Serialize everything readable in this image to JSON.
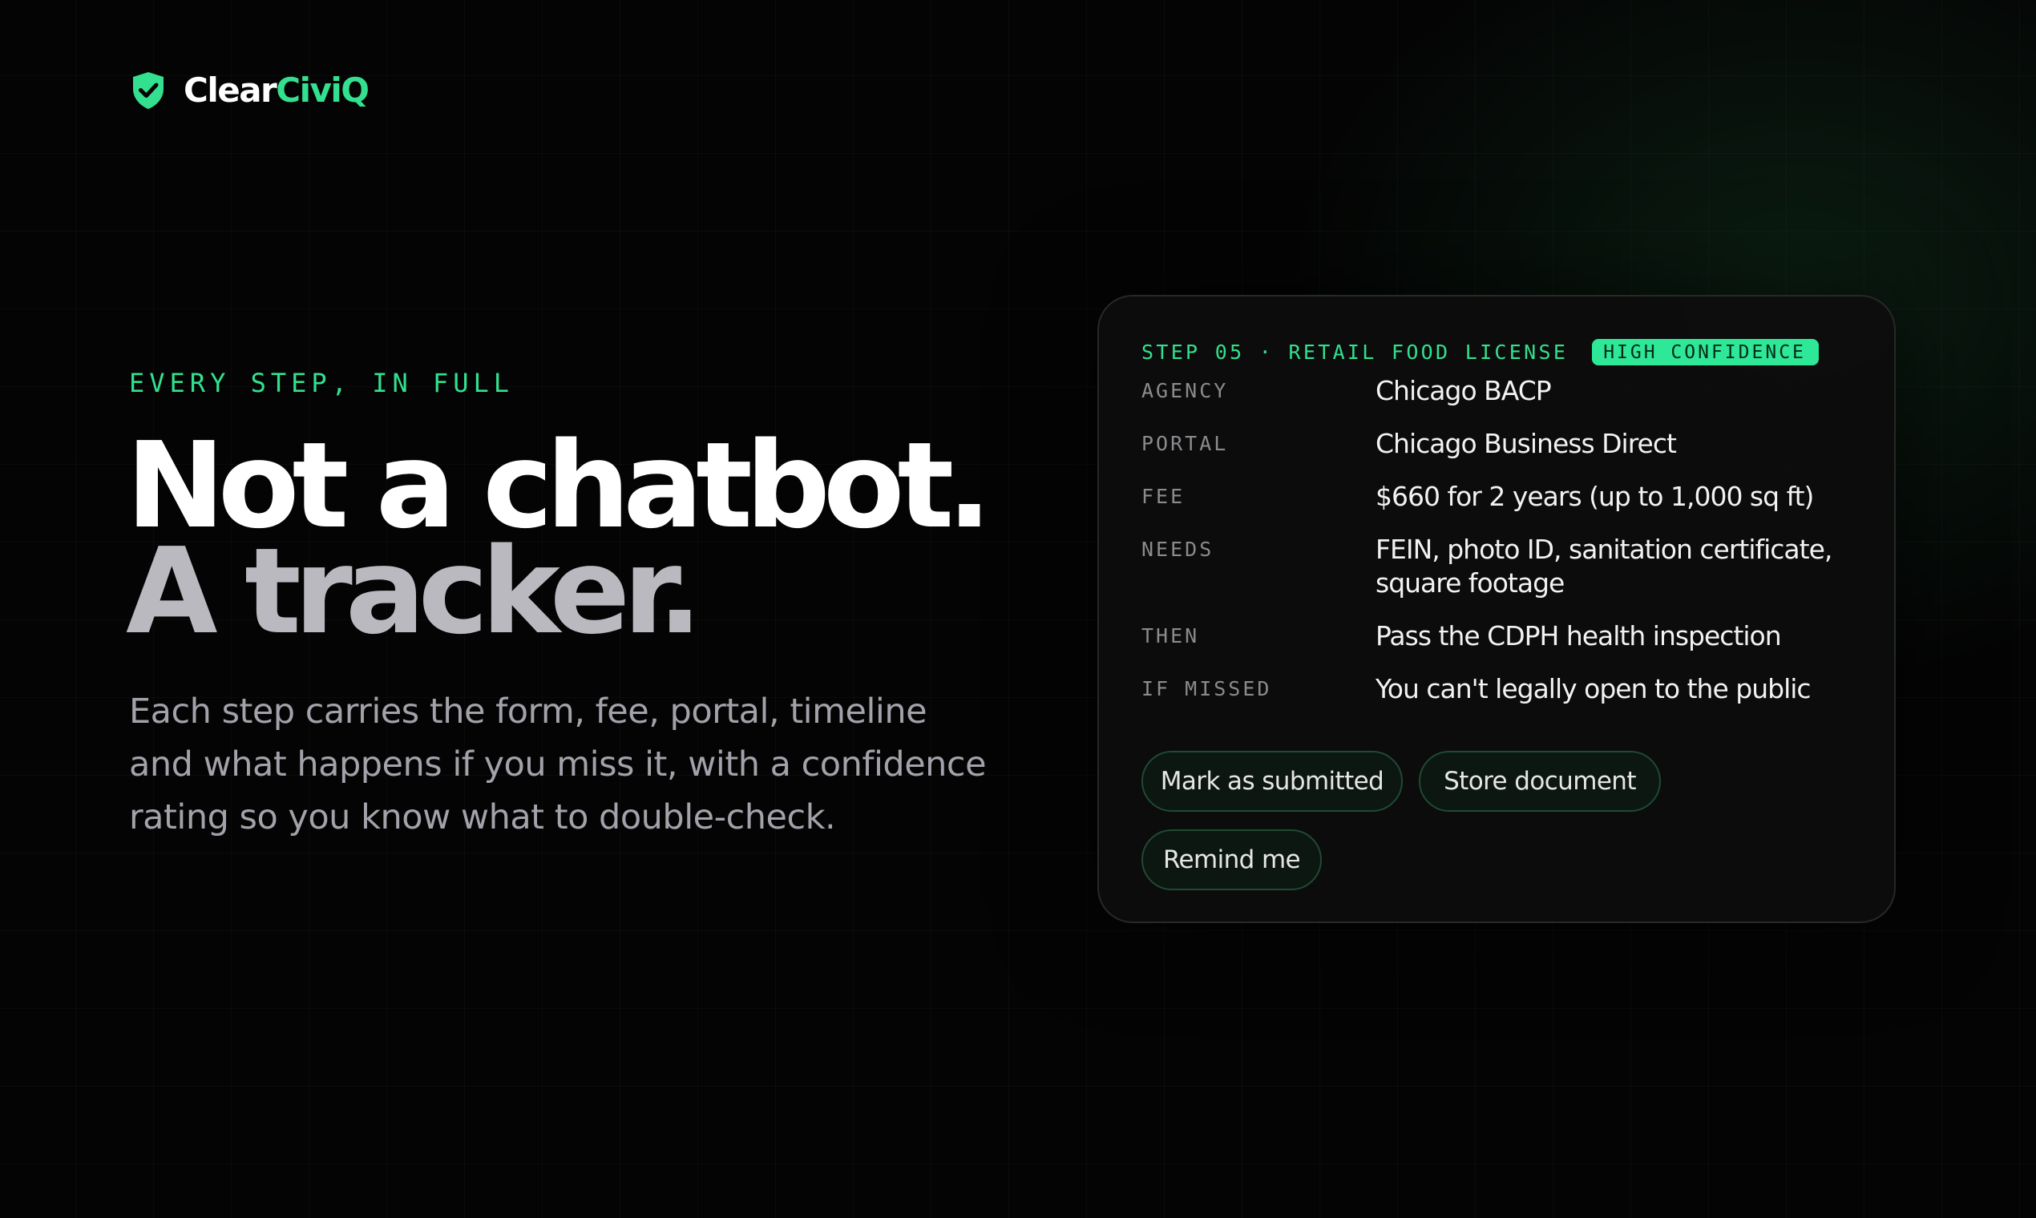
{
  "brand": {
    "name_part1": "Clear",
    "name_part2": "CiviQ",
    "icon": "shield-check-icon",
    "accent_color": "#33e08f"
  },
  "hero": {
    "eyebrow": "EVERY STEP, IN FULL",
    "headline_line1": "Not a chatbot.",
    "headline_line2": "A tracker.",
    "description": "Each step carries the form, fee, portal, timeline and what happens if you miss it, with a confidence rating so you know what to double-check."
  },
  "step_card": {
    "step_label": "STEP 05 · RETAIL FOOD LICENSE",
    "confidence_badge": "HIGH CONFIDENCE",
    "details": [
      {
        "label": "AGENCY",
        "value": "Chicago BACP"
      },
      {
        "label": "PORTAL",
        "value": "Chicago Business Direct"
      },
      {
        "label": "FEE",
        "value": "$660 for 2 years (up to 1,000 sq ft)"
      },
      {
        "label": "NEEDS",
        "value": "FEIN, photo ID, sanitation certificate, square footage"
      },
      {
        "label": "THEN",
        "value": "Pass the CDPH health inspection"
      },
      {
        "label": "IF MISSED",
        "value": "You can't legally open to the public"
      }
    ],
    "actions": {
      "mark_submitted": "Mark as submitted",
      "store_document": "Store document",
      "remind_me": "Remind me"
    }
  }
}
